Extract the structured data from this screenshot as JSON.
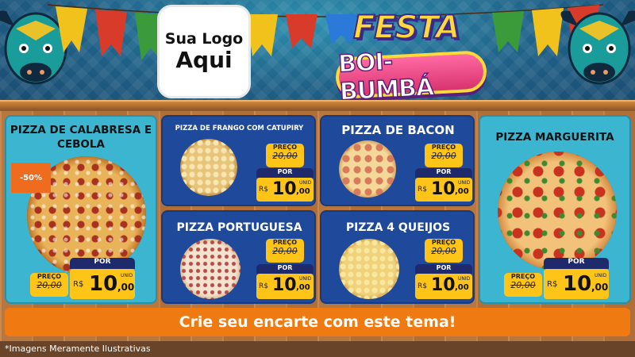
{
  "header": {
    "logo_line1": "Sua Logo",
    "logo_line2": "Aqui",
    "title_top": "FESTA",
    "title_bottom": "BOI-BUMBÁ"
  },
  "products": [
    {
      "name": "PIZZA DE CALABRESA E CEBOLA",
      "discount_badge": "-50%",
      "old_label": "PREÇO",
      "old_price": "20,00",
      "new_label": "POR",
      "currency": "R$",
      "price_int": "10",
      "price_cents": ",00",
      "unit": "UNID"
    },
    {
      "name": "PIZZA DE FRANGO COM CATUPIRY",
      "old_label": "PREÇO",
      "old_price": "20,00",
      "new_label": "POR",
      "currency": "R$",
      "price_int": "10",
      "price_cents": ",00",
      "unit": "UNID"
    },
    {
      "name": "PIZZA DE BACON",
      "old_label": "PREÇO",
      "old_price": "20,00",
      "new_label": "POR",
      "currency": "R$",
      "price_int": "10",
      "price_cents": ",00",
      "unit": "UNID"
    },
    {
      "name": "PIZZA MARGUERITA",
      "old_label": "PREÇO",
      "old_price": "20,00",
      "new_label": "POR",
      "currency": "R$",
      "price_int": "10",
      "price_cents": ",00",
      "unit": "UNID"
    },
    {
      "name": "PIZZA PORTUGUESA",
      "old_label": "PREÇO",
      "old_price": "20,00",
      "new_label": "POR",
      "currency": "R$",
      "price_int": "10",
      "price_cents": ",00",
      "unit": "UNID"
    },
    {
      "name": "PIZZA 4 QUEIJOS",
      "old_label": "PREÇO",
      "old_price": "20,00",
      "new_label": "POR",
      "currency": "R$",
      "price_int": "10",
      "price_cents": ",00",
      "unit": "UNID"
    }
  ],
  "banner": {
    "text": "Crie seu encarte com este tema!"
  },
  "footer": {
    "disclaimer": "*Imagens Meramente Ilustrativas"
  },
  "colors": {
    "header_blue": "#1f5f86",
    "card_teal": "#3cb6d0",
    "card_navy": "#1f4a9c",
    "price_yellow": "#ffc418",
    "price_navy": "#1e2a6c",
    "banner_orange": "#f07a12",
    "badge_orange": "#ef6b1e"
  }
}
